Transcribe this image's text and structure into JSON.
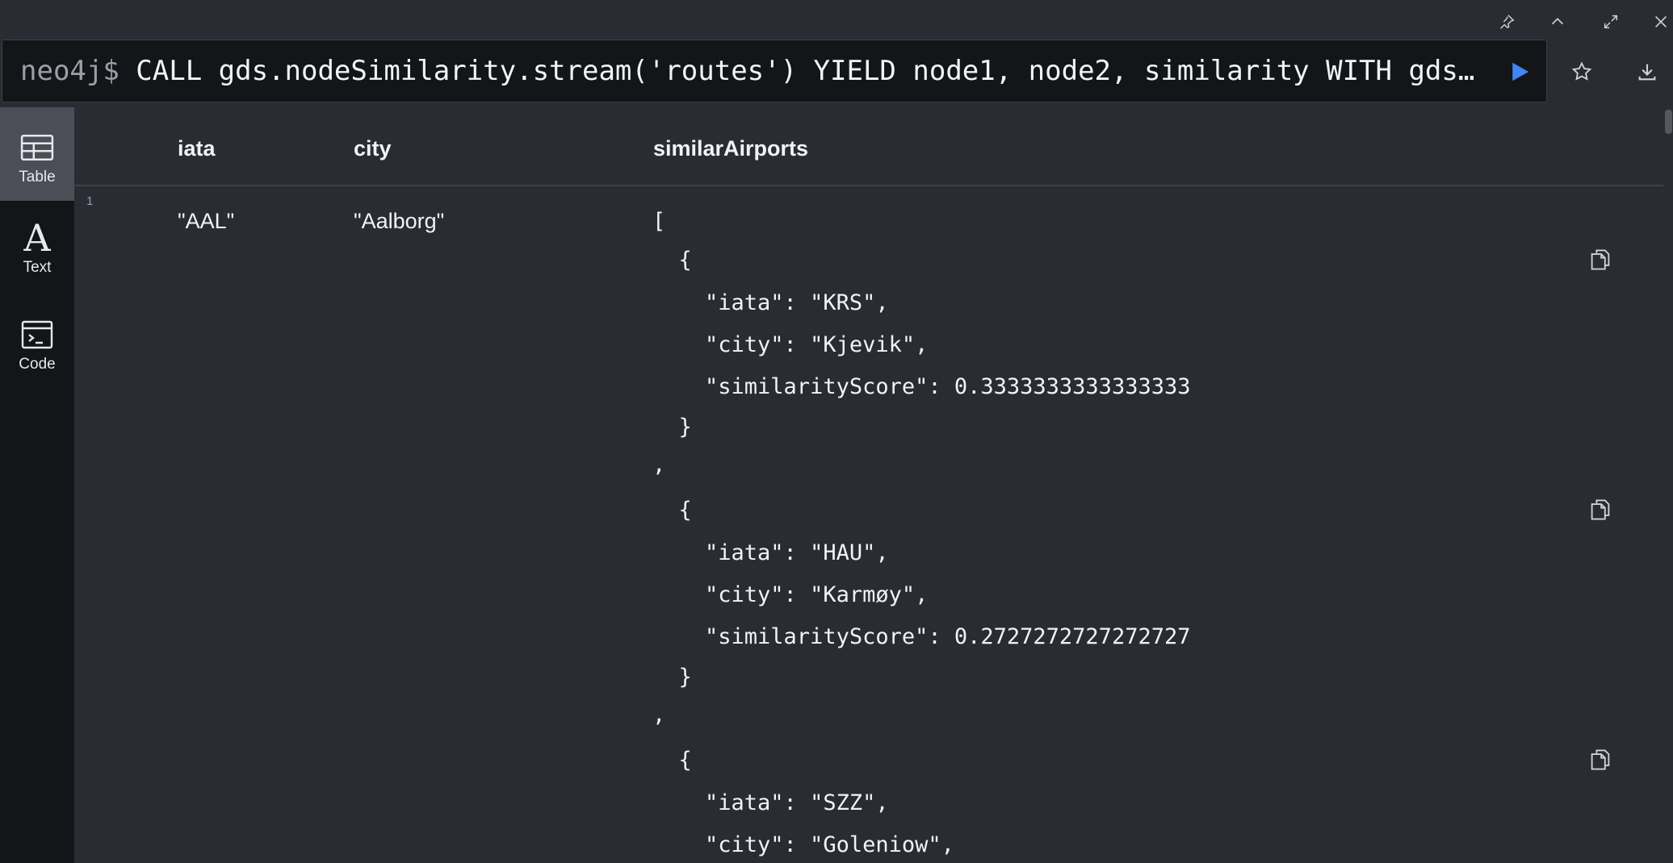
{
  "editor": {
    "prompt": "neo4j$",
    "query": " CALL gds.nodeSimilarity.stream('routes') YIELD node1, node2, similarity WITH gds…"
  },
  "sidebar": {
    "tabs": [
      {
        "label": "Table",
        "icon": "table-icon",
        "active": true
      },
      {
        "label": "Text",
        "icon": "text-icon",
        "active": false
      },
      {
        "label": "Code",
        "icon": "code-icon",
        "active": false
      }
    ]
  },
  "table": {
    "headers": {
      "iata": "iata",
      "city": "city",
      "similar": "similarAirports"
    },
    "row": {
      "index": "1",
      "iata": "\"AAL\"",
      "city": "\"Aalborg\""
    },
    "json_lines": [
      "[",
      "  {",
      "    \"iata\": \"KRS\",",
      "    \"city\": \"Kjevik\",",
      "    \"similarityScore\": 0.3333333333333333",
      "  }",
      ",",
      "  {",
      "    \"iata\": \"HAU\",",
      "    \"city\": \"Karmøy\",",
      "    \"similarityScore\": 0.2727272727272727",
      "  }",
      ",",
      "  {",
      "    \"iata\": \"SZZ\",",
      "    \"city\": \"Goleniow\","
    ]
  },
  "colors": {
    "accent": "#4285f4",
    "background": "#292c33",
    "sidebar": "#141518"
  }
}
